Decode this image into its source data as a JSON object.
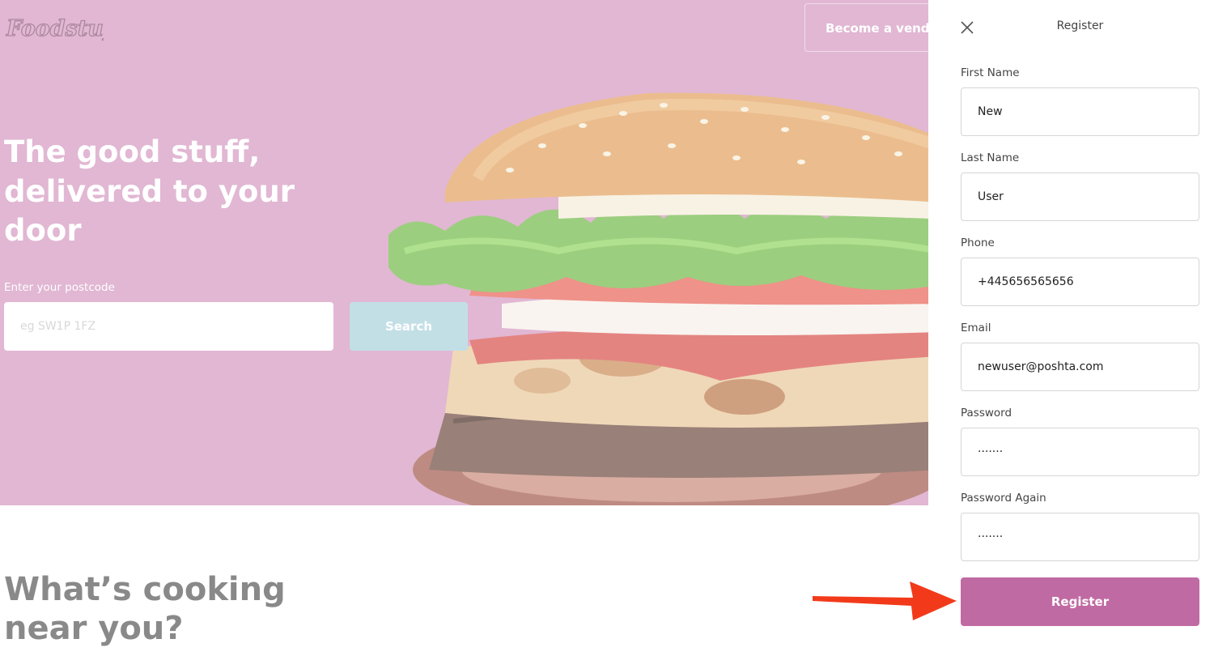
{
  "brand": {
    "logo_text": "Foodstuff"
  },
  "header": {
    "vendor_button": "Become a vendor"
  },
  "hero": {
    "headline": "The good stuff, delivered to your door",
    "postcode_label": "Enter your postcode",
    "postcode_placeholder": "eg SW1P 1FZ",
    "search_button": "Search"
  },
  "section": {
    "cooking_title": "What’s cooking near you?"
  },
  "register_panel": {
    "title": "Register",
    "fields": [
      {
        "label": "First Name",
        "value": "New"
      },
      {
        "label": "Last Name",
        "value": "User"
      },
      {
        "label": "Phone",
        "value": "+445656565656"
      },
      {
        "label": "Email",
        "value": "newuser@poshta.com"
      },
      {
        "label": "Password",
        "value": "·······"
      },
      {
        "label": "Password Again",
        "value": "·······"
      }
    ],
    "submit_button": "Register"
  },
  "colors": {
    "hero_background": "#d498c0",
    "accent": "#c06aa3",
    "search_button": "#a9d1dc",
    "annotation_arrow": "#f23a1a"
  }
}
